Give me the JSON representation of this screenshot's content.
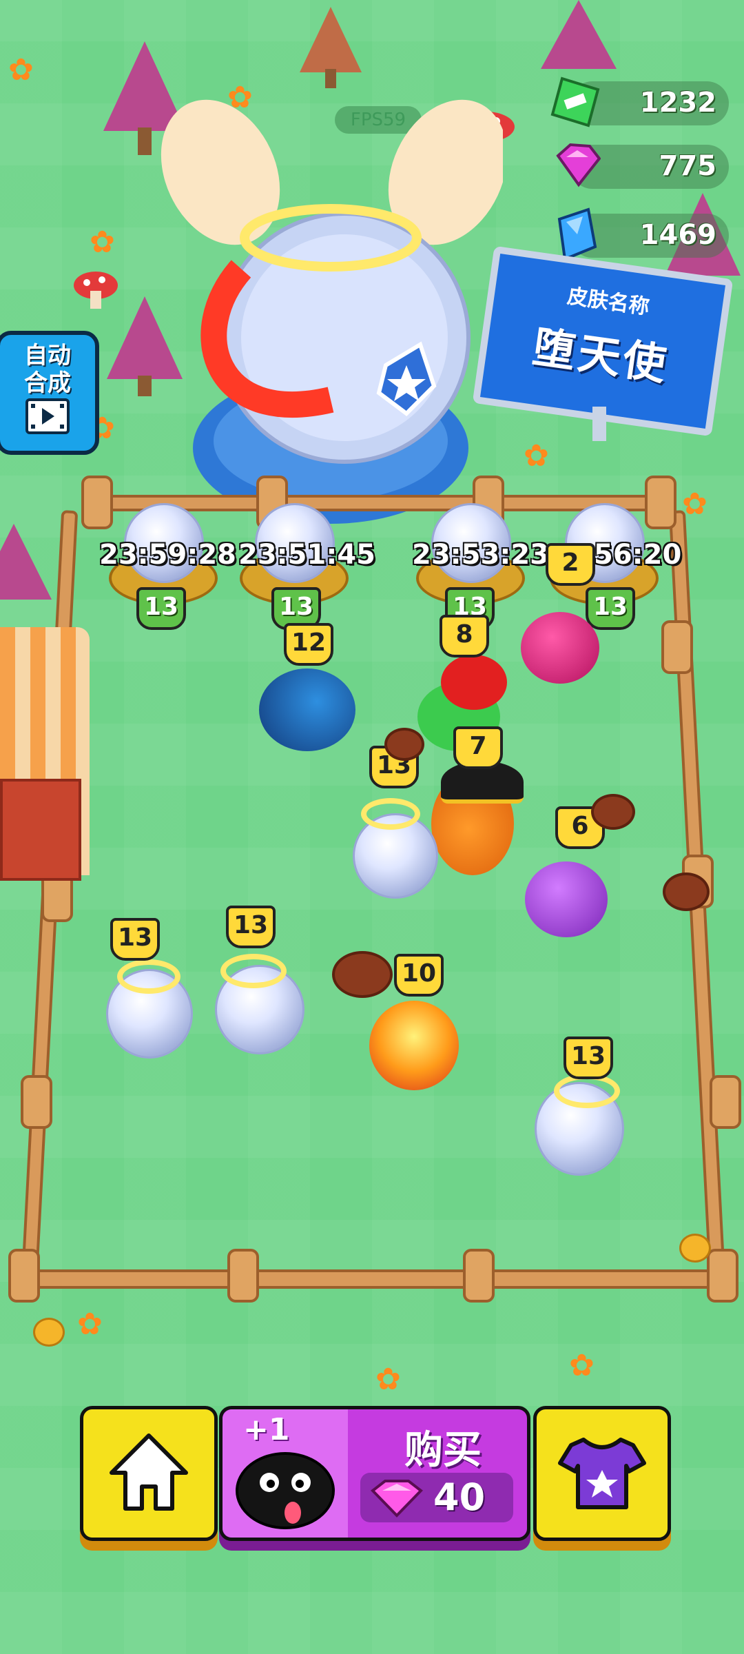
{
  "hud": {
    "fps": "FPS59",
    "currencies": [
      {
        "name": "cash",
        "icon": "cash-icon",
        "value": "1232",
        "color": "#3dd45a"
      },
      {
        "name": "gem",
        "icon": "pink-gem-icon",
        "value": "775",
        "color": "#e43fd8"
      },
      {
        "name": "diamond",
        "icon": "blue-diamond-icon",
        "value": "1469",
        "color": "#3aa8ff"
      }
    ]
  },
  "side": {
    "auto_merge_line1": "自动",
    "auto_merge_line2": "合成",
    "video_icon": "video-ad-icon"
  },
  "skin_board": {
    "caption": "皮肤名称",
    "name": "堕天使"
  },
  "eggs": [
    {
      "timer": "23:59:28",
      "level": "13"
    },
    {
      "timer": "23:51:45",
      "level": "13"
    },
    {
      "timer": "23:53:23",
      "level": "13"
    },
    {
      "timer": "56:20",
      "level": "13",
      "badge": "2"
    }
  ],
  "creatures": [
    {
      "name": "blue-bird-creature",
      "level": "12"
    },
    {
      "name": "green-mushroom-creature",
      "level": "8"
    },
    {
      "name": "pirate-pumpkin-creature",
      "level": "7"
    },
    {
      "name": "angel-egg-creature",
      "level": "13"
    },
    {
      "name": "purple-ghost-creature",
      "level": "6"
    },
    {
      "name": "winged-egg-left-creature",
      "level": "13"
    },
    {
      "name": "winged-egg-mid-creature",
      "level": "13"
    },
    {
      "name": "fire-creature",
      "level": "10"
    },
    {
      "name": "winged-egg-right-creature",
      "level": "13"
    }
  ],
  "bottom_bar": {
    "home_icon": "home-icon",
    "buy_plus": "+1",
    "buy_label": "购买",
    "price": "40",
    "price_icon": "pink-gem-icon",
    "skin_icon": "shirt-icon"
  }
}
